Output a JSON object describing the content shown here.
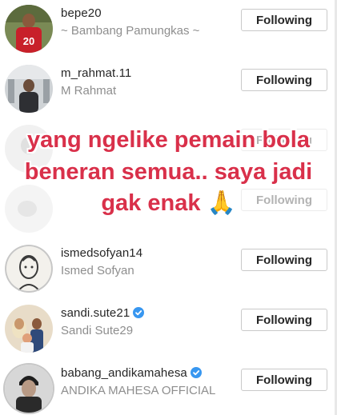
{
  "list": {
    "items": [
      {
        "username": "bepe20",
        "fullname": "~ Bambang Pamungkas ~",
        "button": "Following",
        "verified": false,
        "avatar_icon": "football-player-avatar"
      },
      {
        "username": "m_rahmat.11",
        "fullname": "M Rahmat",
        "button": "Following",
        "verified": false,
        "avatar_icon": "person-airport-avatar"
      },
      {
        "username": "",
        "fullname": "",
        "button": "Following",
        "verified": false,
        "avatar_icon": "blurred-avatar"
      },
      {
        "username": "",
        "fullname": "",
        "button": "Following",
        "verified": false,
        "avatar_icon": "blurred-avatar"
      },
      {
        "username": "ismedsofyan14",
        "fullname": "Ismed Sofyan",
        "button": "Following",
        "verified": false,
        "avatar_icon": "sketch-portrait-avatar"
      },
      {
        "username": "sandi.sute21",
        "fullname": "Sandi Sute29",
        "button": "Following",
        "verified": true,
        "avatar_icon": "family-photo-avatar"
      },
      {
        "username": "babang_andikamahesa",
        "fullname": "ANDIKA MAHESA OFFICIAL",
        "button": "Following",
        "verified": true,
        "avatar_icon": "singer-portrait-avatar"
      }
    ]
  },
  "caption": {
    "line1": "yang ngelike pemain bola",
    "line2": "beneran semua.. saya jadi",
    "line3": "gak enak 🙏"
  },
  "colors": {
    "caption_red": "#d9304a",
    "verified_blue": "#3897f0",
    "button_border": "#c9c9c9",
    "subtext_gray": "#8e8e8e"
  }
}
